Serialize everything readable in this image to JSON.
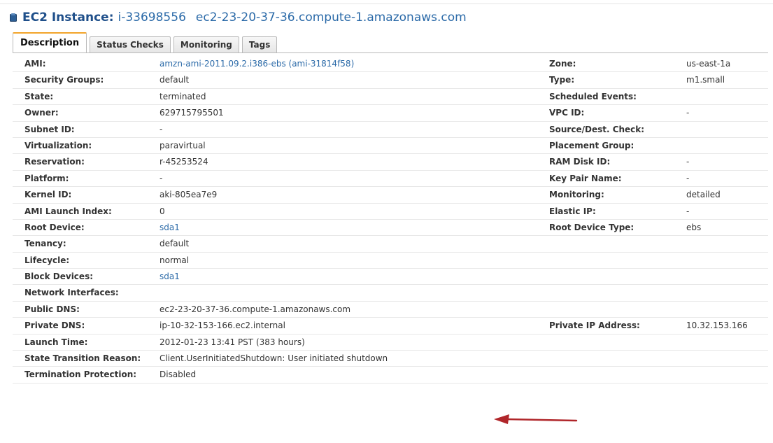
{
  "header": {
    "title": "EC2 Instance:",
    "instance_id": "i-33698556",
    "dns": "ec2-23-20-37-36.compute-1.amazonaws.com"
  },
  "tabs": [
    {
      "label": "Description",
      "active": true
    },
    {
      "label": "Status Checks",
      "active": false
    },
    {
      "label": "Monitoring",
      "active": false
    },
    {
      "label": "Tags",
      "active": false
    }
  ],
  "details": {
    "left": [
      {
        "label": "AMI:",
        "value": "amzn-ami-2011.09.2.i386-ebs (ami-31814f58)",
        "link": true
      },
      {
        "label": "Security Groups:",
        "value": "default",
        "link": false
      },
      {
        "label": "State:",
        "value": "terminated",
        "link": false
      },
      {
        "label": "Owner:",
        "value": "629715795501",
        "link": false
      },
      {
        "label": "Subnet ID:",
        "value": "-",
        "link": false
      },
      {
        "label": "Virtualization:",
        "value": "paravirtual",
        "link": false
      },
      {
        "label": "Reservation:",
        "value": "r-45253524",
        "link": false
      },
      {
        "label": "Platform:",
        "value": "-",
        "link": false
      },
      {
        "label": "Kernel ID:",
        "value": "aki-805ea7e9",
        "link": false
      },
      {
        "label": "AMI Launch Index:",
        "value": "0",
        "link": false
      },
      {
        "label": "Root Device:",
        "value": "sda1",
        "link": true
      },
      {
        "label": "Tenancy:",
        "value": "default",
        "link": false
      },
      {
        "label": "Lifecycle:",
        "value": "normal",
        "link": false
      },
      {
        "label": "Block Devices:",
        "value": "sda1",
        "link": true
      },
      {
        "label": "Network Interfaces:",
        "value": "",
        "link": false
      },
      {
        "label": "Public DNS:",
        "value": "ec2-23-20-37-36.compute-1.amazonaws.com",
        "link": false
      },
      {
        "label": "Private DNS:",
        "value": "ip-10-32-153-166.ec2.internal",
        "link": false
      },
      {
        "label": "Launch Time:",
        "value": "2012-01-23 13:41 PST (383 hours)",
        "link": false
      },
      {
        "label": "State Transition Reason:",
        "value": "Client.UserInitiatedShutdown: User initiated shutdown",
        "link": false
      },
      {
        "label": "Termination Protection:",
        "value": "Disabled",
        "link": false
      }
    ],
    "right": [
      {
        "label": "Zone:",
        "value": "us-east-1a"
      },
      {
        "label": "Type:",
        "value": "m1.small"
      },
      {
        "label": "Scheduled Events:",
        "value": ""
      },
      {
        "label": "VPC ID:",
        "value": "-"
      },
      {
        "label": "Source/Dest. Check:",
        "value": ""
      },
      {
        "label": "Placement Group:",
        "value": ""
      },
      {
        "label": "RAM Disk ID:",
        "value": "-"
      },
      {
        "label": "Key Pair Name:",
        "value": "-"
      },
      {
        "label": "Monitoring:",
        "value": "detailed"
      },
      {
        "label": "Elastic IP:",
        "value": "-"
      },
      {
        "label": "Root Device Type:",
        "value": "ebs"
      },
      {
        "label": "",
        "value": ""
      },
      {
        "label": "",
        "value": ""
      },
      {
        "label": "",
        "value": ""
      },
      {
        "label": "",
        "value": ""
      },
      {
        "label": "",
        "value": ""
      },
      {
        "label": "Private IP Address:",
        "value": "10.32.153.166"
      },
      {
        "label": "",
        "value": ""
      },
      {
        "label": "",
        "value": ""
      },
      {
        "label": "",
        "value": ""
      }
    ]
  },
  "colors": {
    "title": "#1f4f8a",
    "link": "#2b6aa8",
    "active_tab_accent": "#f2a52b",
    "annotation_arrow": "#b0262a"
  },
  "icons": {
    "header": "ec2-instance-icon",
    "annotation": "red-arrow-icon"
  }
}
